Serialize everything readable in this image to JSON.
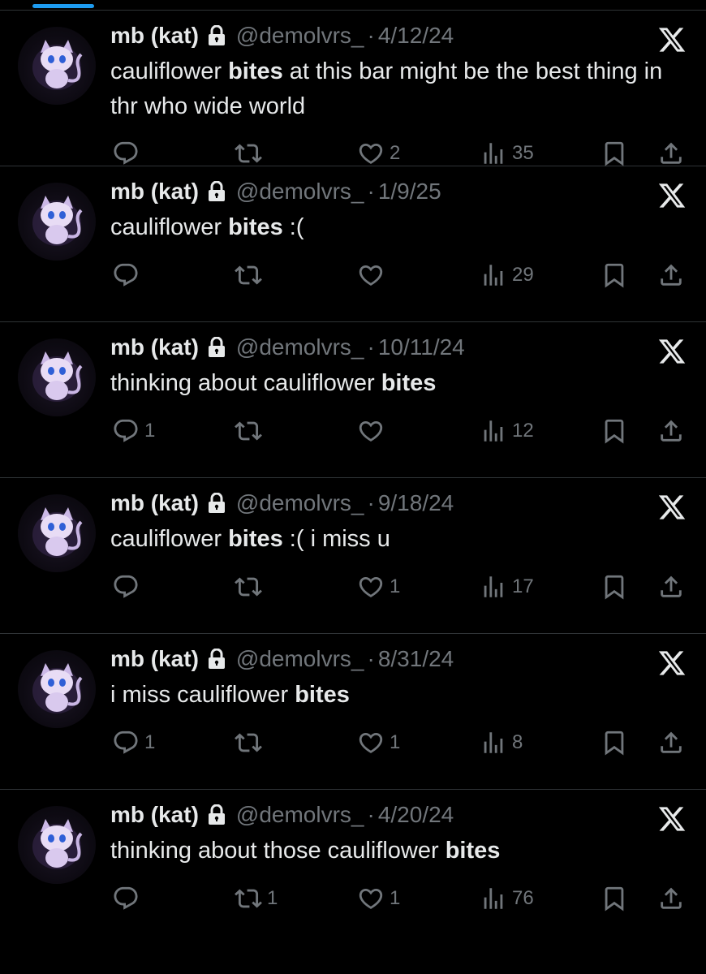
{
  "colors": {
    "background": "#000000",
    "text": "#e7e9ea",
    "muted": "#71767b",
    "divider": "#2f3336",
    "accent": "#1d9bf0"
  },
  "icons": {
    "reply": "reply-icon",
    "retweet": "retweet-icon",
    "like": "heart-icon",
    "views": "views-icon",
    "bookmark": "bookmark-icon",
    "share": "share-icon",
    "protected": "lock-icon",
    "logo": "x-logo-icon"
  },
  "tweets": [
    {
      "name": "mb (kat)",
      "handle": "@demolvrs_",
      "sep": "·",
      "date": "4/12/24",
      "text_before": "cauliflower ",
      "text_bold": "bites",
      "text_after": " at this bar might be the best thing in thr who wide world",
      "replies": "",
      "retweets": "",
      "likes": "2",
      "views": "35"
    },
    {
      "name": "mb (kat)",
      "handle": "@demolvrs_",
      "sep": "·",
      "date": "1/9/25",
      "text_before": "cauliflower ",
      "text_bold": "bites",
      "text_after": " :(",
      "replies": "",
      "retweets": "",
      "likes": "",
      "views": "29"
    },
    {
      "name": "mb (kat)",
      "handle": "@demolvrs_",
      "sep": "·",
      "date": "10/11/24",
      "text_before": "thinking about cauliflower ",
      "text_bold": "bites",
      "text_after": "",
      "replies": "1",
      "retweets": "",
      "likes": "",
      "views": "12"
    },
    {
      "name": "mb (kat)",
      "handle": "@demolvrs_",
      "sep": "·",
      "date": "9/18/24",
      "text_before": "cauliflower ",
      "text_bold": "bites",
      "text_after": " :( i miss u",
      "replies": "",
      "retweets": "",
      "likes": "1",
      "views": "17"
    },
    {
      "name": "mb (kat)",
      "handle": "@demolvrs_",
      "sep": "·",
      "date": "8/31/24",
      "text_before": "i miss cauliflower ",
      "text_bold": "bites",
      "text_after": "",
      "replies": "1",
      "retweets": "",
      "likes": "1",
      "views": "8"
    },
    {
      "name": "mb (kat)",
      "handle": "@demolvrs_",
      "sep": "·",
      "date": "4/20/24",
      "text_before": "thinking about those cauliflower ",
      "text_bold": "bites",
      "text_after": "",
      "replies": "",
      "retweets": "1",
      "likes": "1",
      "views": "76"
    }
  ]
}
